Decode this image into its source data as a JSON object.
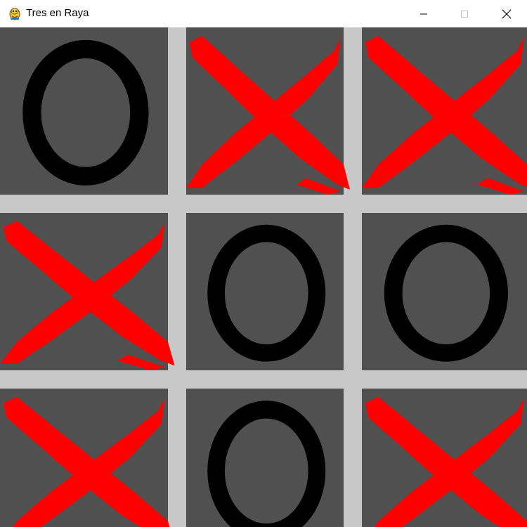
{
  "window": {
    "title": "Tres en Raya",
    "app_icon": "pygame-snake-icon",
    "controls": [
      "minimize-icon",
      "maximize-icon",
      "close-icon"
    ]
  },
  "colors": {
    "board_lines": "#c8c8c8",
    "cell_background": "#505050",
    "o_mark": "#000000",
    "x_mark": "#ff0000"
  },
  "board": {
    "cells": [
      [
        "O",
        "X",
        "X"
      ],
      [
        "X",
        "O",
        "O"
      ],
      [
        "X",
        "O",
        "X"
      ]
    ]
  }
}
